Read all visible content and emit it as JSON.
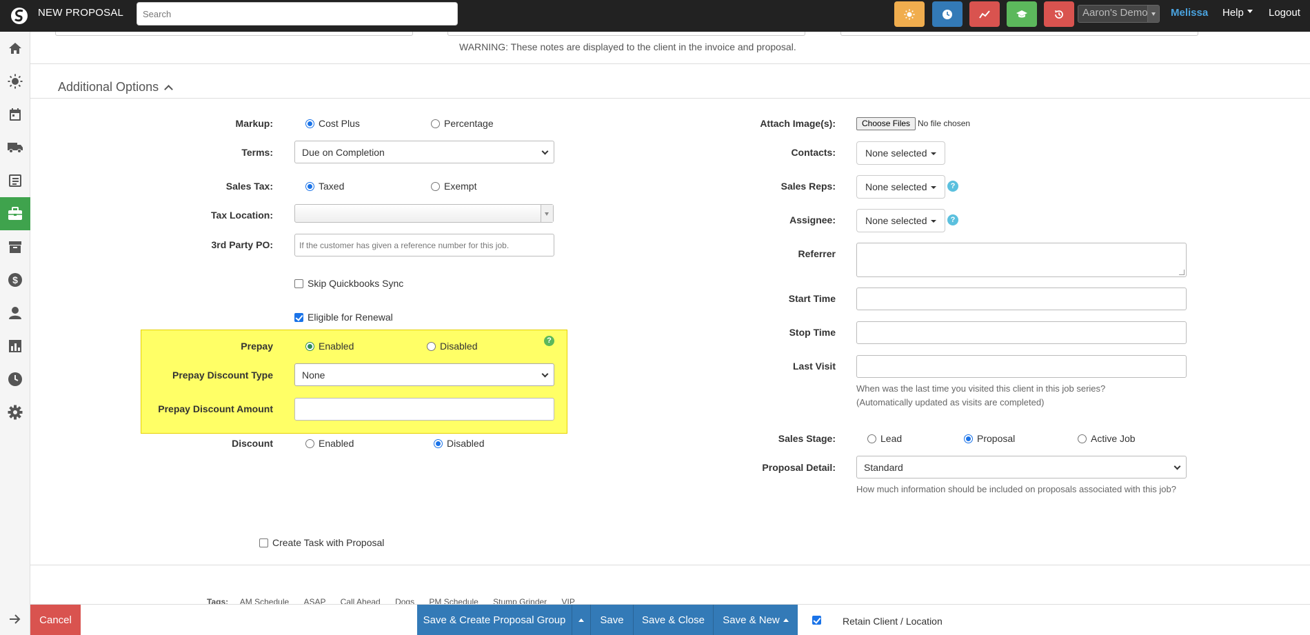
{
  "header": {
    "title": "NEW PROPOSAL",
    "search_placeholder": "Search",
    "quick_buttons": [
      {
        "icon": "sun-icon",
        "color": "#f0ad4e"
      },
      {
        "icon": "clock-icon",
        "color": "#337ab7"
      },
      {
        "icon": "trend-line-icon",
        "color": "#d9534f"
      },
      {
        "icon": "graduation-cap-icon",
        "color": "#5cb85c"
      },
      {
        "icon": "history-icon",
        "color": "#d9534f"
      }
    ],
    "account": "Aaron's Demo",
    "user": "Melissa",
    "help": "Help",
    "logout": "Logout"
  },
  "sidebar": {
    "items": [
      {
        "icon": "home-icon"
      },
      {
        "icon": "sun-icon"
      },
      {
        "icon": "calendar-icon"
      },
      {
        "icon": "truck-icon"
      },
      {
        "icon": "book-icon"
      },
      {
        "icon": "briefcase-icon",
        "active": true
      },
      {
        "icon": "archive-icon"
      },
      {
        "icon": "dollar-icon"
      },
      {
        "icon": "user-icon"
      },
      {
        "icon": "bar-chart-icon"
      },
      {
        "icon": "clock-icon"
      },
      {
        "icon": "gear-icon"
      }
    ],
    "expand_icon": "arrow-right-icon"
  },
  "main": {
    "warning": "WARNING: These notes are displayed to the client in the invoice and proposal.",
    "section_title": "Additional Options",
    "left": {
      "markup": {
        "label": "Markup:",
        "opt1": "Cost Plus",
        "opt2": "Percentage",
        "selected": "Cost Plus"
      },
      "terms": {
        "label": "Terms:",
        "value": "Due on Completion"
      },
      "sales_tax": {
        "label": "Sales Tax:",
        "opt1": "Taxed",
        "opt2": "Exempt",
        "selected": "Taxed"
      },
      "tax_location": {
        "label": "Tax Location:",
        "value": ""
      },
      "third_party_po": {
        "label": "3rd Party PO:",
        "placeholder": "If the customer has given a reference number for this job."
      },
      "skip_qb": {
        "label": "Skip Quickbooks Sync",
        "checked": false
      },
      "eligible_renewal": {
        "label": "Eligible for Renewal",
        "checked": true
      },
      "prepay": {
        "label": "Prepay",
        "opt1": "Enabled",
        "opt2": "Disabled",
        "selected": "Enabled"
      },
      "prepay_discount_type": {
        "label": "Prepay Discount Type",
        "value": "None"
      },
      "prepay_discount_amount": {
        "label": "Prepay Discount Amount",
        "value": ""
      },
      "discount": {
        "label": "Discount",
        "opt1": "Enabled",
        "opt2": "Disabled",
        "selected": "Disabled"
      },
      "create_task": {
        "label": "Create Task with Proposal",
        "checked": false
      }
    },
    "right": {
      "attach": {
        "label": "Attach Image(s):",
        "button": "Choose Files",
        "status": "No file chosen"
      },
      "contacts": {
        "label": "Contacts:",
        "value": "None selected"
      },
      "sales_reps": {
        "label": "Sales Reps:",
        "value": "None selected"
      },
      "assignee": {
        "label": "Assignee:",
        "value": "None selected"
      },
      "referrer": {
        "label": "Referrer",
        "value": ""
      },
      "start_time": {
        "label": "Start Time",
        "value": ""
      },
      "stop_time": {
        "label": "Stop Time",
        "value": ""
      },
      "last_visit": {
        "label": "Last Visit",
        "value": "",
        "help1": "When was the last time you visited this client in this job series?",
        "help2": "(Automatically updated as visits are completed)"
      },
      "sales_stage": {
        "label": "Sales Stage:",
        "opt1": "Lead",
        "opt2": "Proposal",
        "opt3": "Active Job",
        "selected": "Proposal"
      },
      "proposal_detail": {
        "label": "Proposal Detail:",
        "value": "Standard",
        "help": "How much information should be included on proposals associated with this job?"
      }
    },
    "tags": {
      "label": "Tags:",
      "items": [
        "AM Schedule",
        "ASAP",
        "Call Ahead",
        "Dogs",
        "PM Schedule",
        "Stump Grinder",
        "VIP"
      ]
    }
  },
  "footer": {
    "cancel": "Cancel",
    "save_group": "Save & Create Proposal Group",
    "save": "Save",
    "save_close": "Save & Close",
    "save_new": "Save & New",
    "retain": "Retain Client / Location",
    "retain_checked": true
  }
}
